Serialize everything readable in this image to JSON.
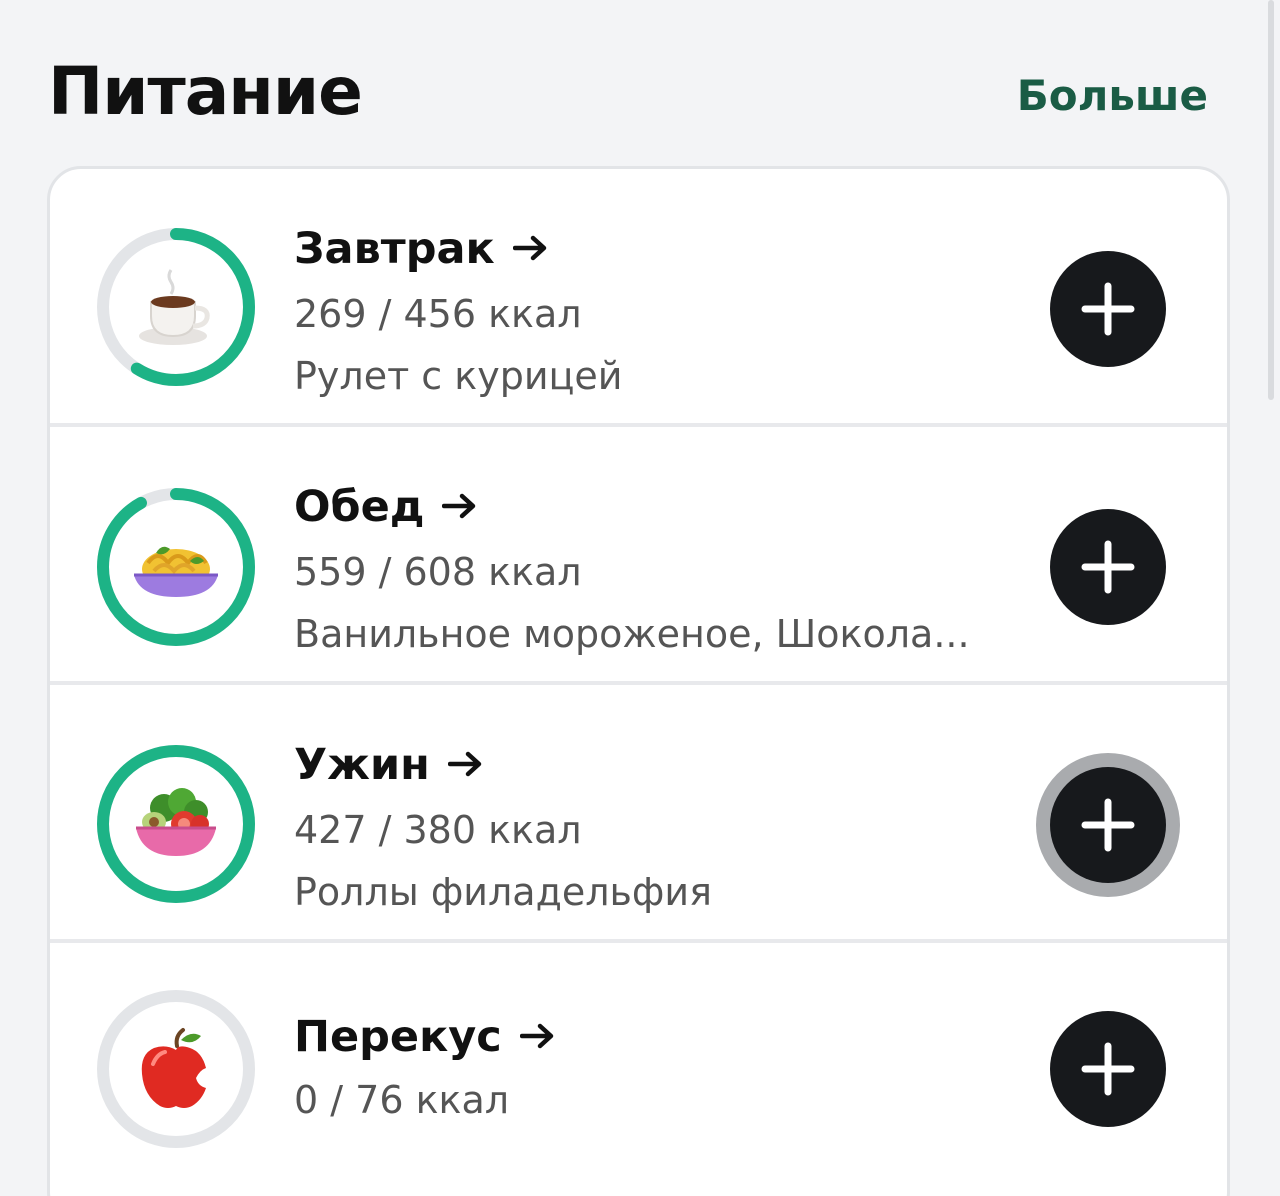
{
  "header": {
    "title": "Питание",
    "more_label": "Больше"
  },
  "meals": [
    {
      "name": "Завтрак",
      "kcal": "269 / 456 ккал",
      "foods": "Рулет с курицей",
      "progress": 0.59,
      "icon": "coffee-cup-icon"
    },
    {
      "name": "Обед",
      "kcal": "559 / 608 ккал",
      "foods": "Ванильное мороженое, Шокола...",
      "progress": 0.92,
      "icon": "pasta-bowl-icon"
    },
    {
      "name": "Ужин",
      "kcal": "427 / 380 ккал",
      "foods": "Роллы филадельфия",
      "progress": 1.0,
      "icon": "salad-bowl-icon"
    },
    {
      "name": "Перекус",
      "kcal": "0 / 76 ккал",
      "foods": "",
      "progress": 0.0,
      "icon": "apple-icon"
    }
  ],
  "colors": {
    "ring_progress": "#1db386",
    "ring_track": "#e3e5e8",
    "accent_link": "#1a5c45",
    "add_button": "#17191c"
  }
}
